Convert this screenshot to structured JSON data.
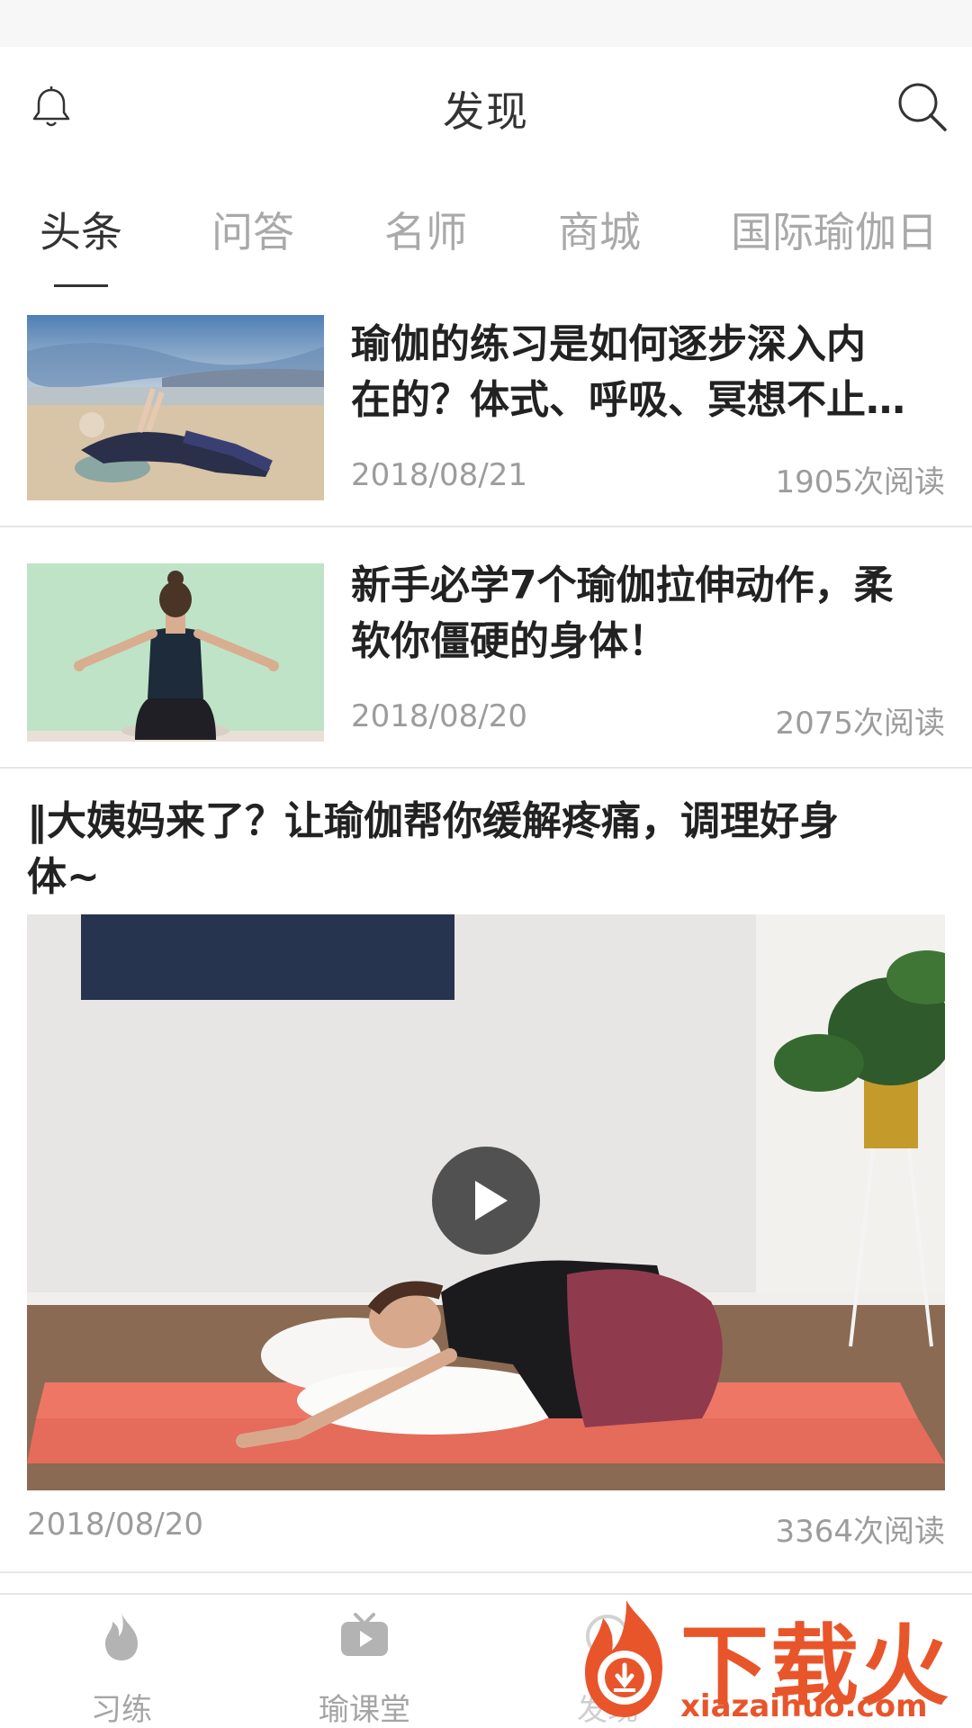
{
  "header": {
    "title": "发现"
  },
  "tabs": [
    {
      "label": "头条",
      "active": true
    },
    {
      "label": "问答",
      "active": false
    },
    {
      "label": "名师",
      "active": false
    },
    {
      "label": "商城",
      "active": false
    },
    {
      "label": "国际瑜伽日",
      "active": false
    }
  ],
  "articles": [
    {
      "headline_line1": "瑜伽的练习是如何逐步深入内",
      "headline_line2": "在的？体式、呼吸、冥想不止…",
      "date": "2018/08/21",
      "reads": "1905次阅读"
    },
    {
      "headline_line1": "新手必学7个瑜伽拉伸动作，柔",
      "headline_line2": "软你僵硬的身体！",
      "date": "2018/08/20",
      "reads": "2075次阅读"
    }
  ],
  "video_article": {
    "headline_line1": "‖大姨妈来了？让瑜伽帮你缓解疼痛，调理好身",
    "headline_line2": "体~",
    "date": "2018/08/20",
    "reads": "3364次阅读"
  },
  "bottom_nav": [
    {
      "label": "习练",
      "icon": "flame-icon"
    },
    {
      "label": "瑜课堂",
      "icon": "tv-play-icon"
    },
    {
      "label": "发现",
      "icon": "discover-icon"
    }
  ],
  "watermark": {
    "text": "下载火",
    "url": "xiazaihuo.com"
  },
  "colors": {
    "accent_watermark": "#e8552b",
    "muted_text": "#9c9c9c",
    "tab_inactive": "#a9a9a9"
  }
}
